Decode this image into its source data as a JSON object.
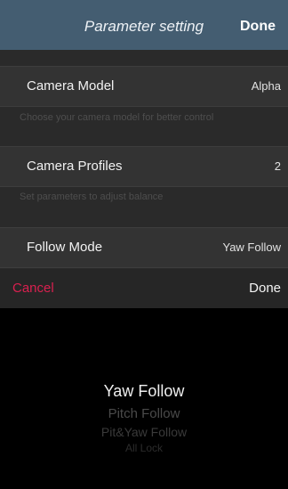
{
  "nav": {
    "title": "Parameter setting",
    "done_label": "Done"
  },
  "settings": {
    "camera_model": {
      "label": "Camera Model",
      "value": "Alpha",
      "hint": "Choose your camera model for better control"
    },
    "camera_profiles": {
      "label": "Camera Profiles",
      "value": "2",
      "hint": "Set parameters to adjust balance"
    },
    "follow_mode": {
      "label": "Follow Mode",
      "value": "Yaw Follow"
    }
  },
  "picker": {
    "cancel_label": "Cancel",
    "done_label": "Done",
    "options": [
      "Yaw Follow",
      "Pitch Follow",
      "Pit&Yaw Follow",
      "All Lock"
    ],
    "selected": "Yaw Follow"
  },
  "colors": {
    "nav_bg": "#445d71",
    "cancel": "#d9204f"
  }
}
